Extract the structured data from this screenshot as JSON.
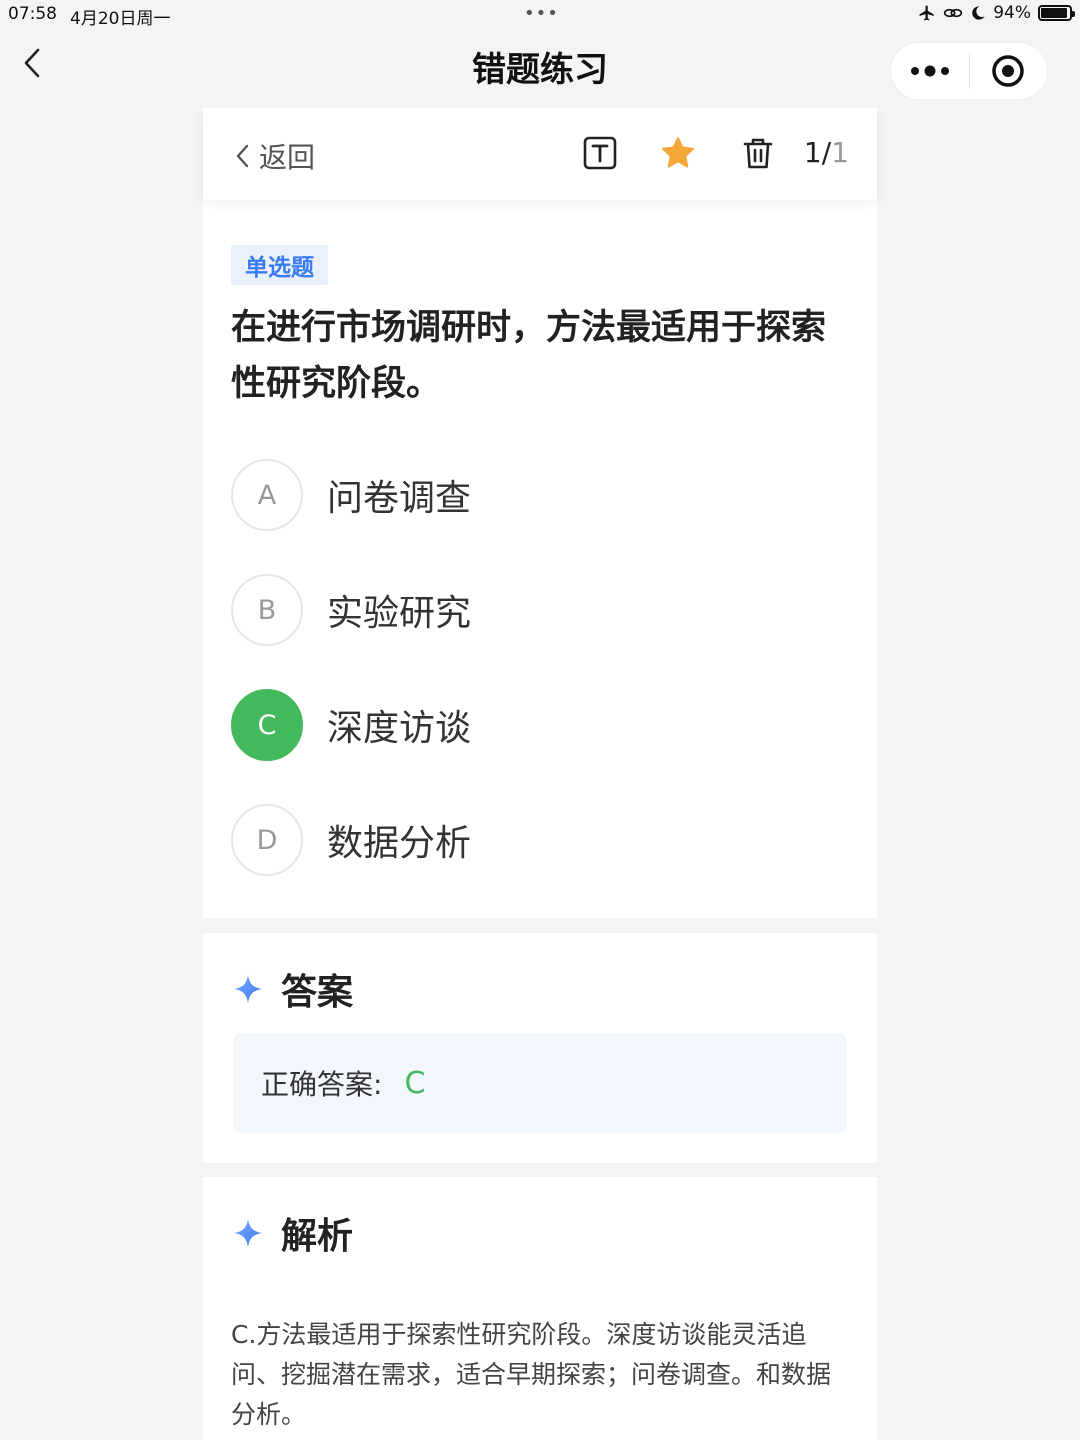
{
  "status_bar": {
    "time": "07:58",
    "date": "4月20日周一",
    "dots": "•••",
    "battery": "94%",
    "battery_level": 0.94
  },
  "nav": {
    "title": "错题练习"
  },
  "toolbar": {
    "back_label": "返回",
    "counter_current": "1/",
    "counter_total": "1",
    "star_color": "#f4a83a"
  },
  "question": {
    "type": "单选题",
    "text": "在进行市场调研时，方法最适用于探索性研究阶段。",
    "options": [
      {
        "letter": "A",
        "text": "问卷调查"
      },
      {
        "letter": "B",
        "text": "实验研究"
      },
      {
        "letter": "C",
        "text": "深度访谈"
      },
      {
        "letter": "D",
        "text": "数据分析"
      }
    ],
    "selected": "C"
  },
  "answer": {
    "title": "答案",
    "label": "正确答案:",
    "value": "C"
  },
  "analysis": {
    "title": "解析",
    "text": "C.方法最适用于探索性研究阶段。深度访谈能灵活追问、挖掘潜在需求，适合早期探索；问卷调查。和数据分析。"
  },
  "colors": {
    "accent_blue": "#3a7cf0",
    "correct_green": "#43b85c"
  }
}
